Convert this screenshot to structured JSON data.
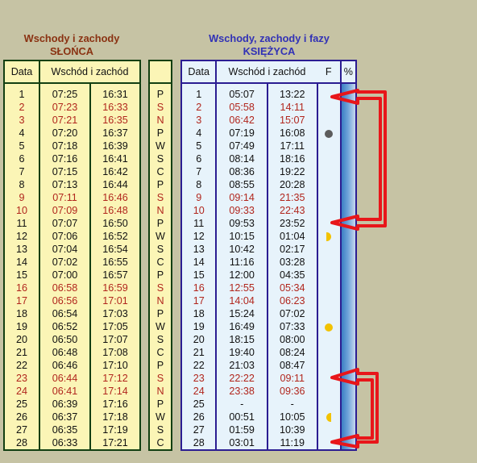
{
  "sun": {
    "title_line1": "Wschody i zachody",
    "title_line2": "SŁOŃCA",
    "col_date": "Data",
    "col_rise_set": "Wschód i zachód",
    "rows": [
      {
        "day": "1",
        "rise": "07:25",
        "set": "16:31",
        "weekend": false
      },
      {
        "day": "2",
        "rise": "07:23",
        "set": "16:33",
        "weekend": true
      },
      {
        "day": "3",
        "rise": "07:21",
        "set": "16:35",
        "weekend": true
      },
      {
        "day": "4",
        "rise": "07:20",
        "set": "16:37",
        "weekend": false
      },
      {
        "day": "5",
        "rise": "07:18",
        "set": "16:39",
        "weekend": false
      },
      {
        "day": "6",
        "rise": "07:16",
        "set": "16:41",
        "weekend": false
      },
      {
        "day": "7",
        "rise": "07:15",
        "set": "16:42",
        "weekend": false
      },
      {
        "day": "8",
        "rise": "07:13",
        "set": "16:44",
        "weekend": false
      },
      {
        "day": "9",
        "rise": "07:11",
        "set": "16:46",
        "weekend": true
      },
      {
        "day": "10",
        "rise": "07:09",
        "set": "16:48",
        "weekend": true
      },
      {
        "day": "11",
        "rise": "07:07",
        "set": "16:50",
        "weekend": false
      },
      {
        "day": "12",
        "rise": "07:06",
        "set": "16:52",
        "weekend": false
      },
      {
        "day": "13",
        "rise": "07:04",
        "set": "16:54",
        "weekend": false
      },
      {
        "day": "14",
        "rise": "07:02",
        "set": "16:55",
        "weekend": false
      },
      {
        "day": "15",
        "rise": "07:00",
        "set": "16:57",
        "weekend": false
      },
      {
        "day": "16",
        "rise": "06:58",
        "set": "16:59",
        "weekend": true
      },
      {
        "day": "17",
        "rise": "06:56",
        "set": "17:01",
        "weekend": true
      },
      {
        "day": "18",
        "rise": "06:54",
        "set": "17:03",
        "weekend": false
      },
      {
        "day": "19",
        "rise": "06:52",
        "set": "17:05",
        "weekend": false
      },
      {
        "day": "20",
        "rise": "06:50",
        "set": "17:07",
        "weekend": false
      },
      {
        "day": "21",
        "rise": "06:48",
        "set": "17:08",
        "weekend": false
      },
      {
        "day": "22",
        "rise": "06:46",
        "set": "17:10",
        "weekend": false
      },
      {
        "day": "23",
        "rise": "06:44",
        "set": "17:12",
        "weekend": true
      },
      {
        "day": "24",
        "rise": "06:41",
        "set": "17:14",
        "weekend": true
      },
      {
        "day": "25",
        "rise": "06:39",
        "set": "17:16",
        "weekend": false
      },
      {
        "day": "26",
        "rise": "06:37",
        "set": "17:18",
        "weekend": false
      },
      {
        "day": "27",
        "rise": "06:35",
        "set": "17:19",
        "weekend": false
      },
      {
        "day": "28",
        "rise": "06:33",
        "set": "17:21",
        "weekend": false
      }
    ]
  },
  "weekdays": {
    "header": "",
    "letters": [
      "P",
      "S",
      "N",
      "P",
      "W",
      "S",
      "C",
      "P",
      "S",
      "N",
      "P",
      "W",
      "S",
      "C",
      "P",
      "S",
      "N",
      "P",
      "W",
      "S",
      "C",
      "P",
      "S",
      "N",
      "P",
      "W",
      "S",
      "C"
    ]
  },
  "moon": {
    "title_line1": "Wschody, zachody i fazy",
    "title_line2": "KSIĘŻYCA",
    "col_date": "Data",
    "col_rise_set": "Wschód i zachód",
    "col_phase": "F",
    "col_percent": "%",
    "rows": [
      {
        "day": "1",
        "rise": "05:07",
        "set": "13:22",
        "weekend": false,
        "phase": ""
      },
      {
        "day": "2",
        "rise": "05:58",
        "set": "14:11",
        "weekend": true,
        "phase": ""
      },
      {
        "day": "3",
        "rise": "06:42",
        "set": "15:07",
        "weekend": true,
        "phase": ""
      },
      {
        "day": "4",
        "rise": "07:19",
        "set": "16:08",
        "weekend": false,
        "phase": "new-moon"
      },
      {
        "day": "5",
        "rise": "07:49",
        "set": "17:11",
        "weekend": false,
        "phase": ""
      },
      {
        "day": "6",
        "rise": "08:14",
        "set": "18:16",
        "weekend": false,
        "phase": ""
      },
      {
        "day": "7",
        "rise": "08:36",
        "set": "19:22",
        "weekend": false,
        "phase": ""
      },
      {
        "day": "8",
        "rise": "08:55",
        "set": "20:28",
        "weekend": false,
        "phase": ""
      },
      {
        "day": "9",
        "rise": "09:14",
        "set": "21:35",
        "weekend": true,
        "phase": ""
      },
      {
        "day": "10",
        "rise": "09:33",
        "set": "22:43",
        "weekend": true,
        "phase": ""
      },
      {
        "day": "11",
        "rise": "09:53",
        "set": "23:52",
        "weekend": false,
        "phase": ""
      },
      {
        "day": "12",
        "rise": "10:15",
        "set": "01:04",
        "weekend": false,
        "phase": "first-quarter"
      },
      {
        "day": "13",
        "rise": "10:42",
        "set": "02:17",
        "weekend": false,
        "phase": ""
      },
      {
        "day": "14",
        "rise": "11:16",
        "set": "03:28",
        "weekend": false,
        "phase": ""
      },
      {
        "day": "15",
        "rise": "12:00",
        "set": "04:35",
        "weekend": false,
        "phase": ""
      },
      {
        "day": "16",
        "rise": "12:55",
        "set": "05:34",
        "weekend": true,
        "phase": ""
      },
      {
        "day": "17",
        "rise": "14:04",
        "set": "06:23",
        "weekend": true,
        "phase": ""
      },
      {
        "day": "18",
        "rise": "15:24",
        "set": "07:02",
        "weekend": false,
        "phase": ""
      },
      {
        "day": "19",
        "rise": "16:49",
        "set": "07:33",
        "weekend": false,
        "phase": "full-moon"
      },
      {
        "day": "20",
        "rise": "18:15",
        "set": "08:00",
        "weekend": false,
        "phase": ""
      },
      {
        "day": "21",
        "rise": "19:40",
        "set": "08:24",
        "weekend": false,
        "phase": ""
      },
      {
        "day": "22",
        "rise": "21:03",
        "set": "08:47",
        "weekend": false,
        "phase": ""
      },
      {
        "day": "23",
        "rise": "22:22",
        "set": "09:11",
        "weekend": true,
        "phase": ""
      },
      {
        "day": "24",
        "rise": "23:38",
        "set": "09:36",
        "weekend": true,
        "phase": ""
      },
      {
        "day": "25",
        "rise": "-",
        "set": "-",
        "weekend": false,
        "phase": ""
      },
      {
        "day": "26",
        "rise": "00:51",
        "set": "10:05",
        "weekend": false,
        "phase": "last-quarter"
      },
      {
        "day": "27",
        "rise": "01:59",
        "set": "10:39",
        "weekend": false,
        "phase": ""
      },
      {
        "day": "28",
        "rise": "03:01",
        "set": "11:19",
        "weekend": false,
        "phase": ""
      }
    ]
  },
  "colors": {
    "background": "#c6c3a4",
    "sun_title": "#8a3212",
    "moon_title": "#3131b6",
    "weekend_text": "#b1261d",
    "sun_table_bg": "#fbf5b6",
    "moon_table_bg": "#e7f3fb",
    "annotation_arrows": "#e8161a"
  }
}
